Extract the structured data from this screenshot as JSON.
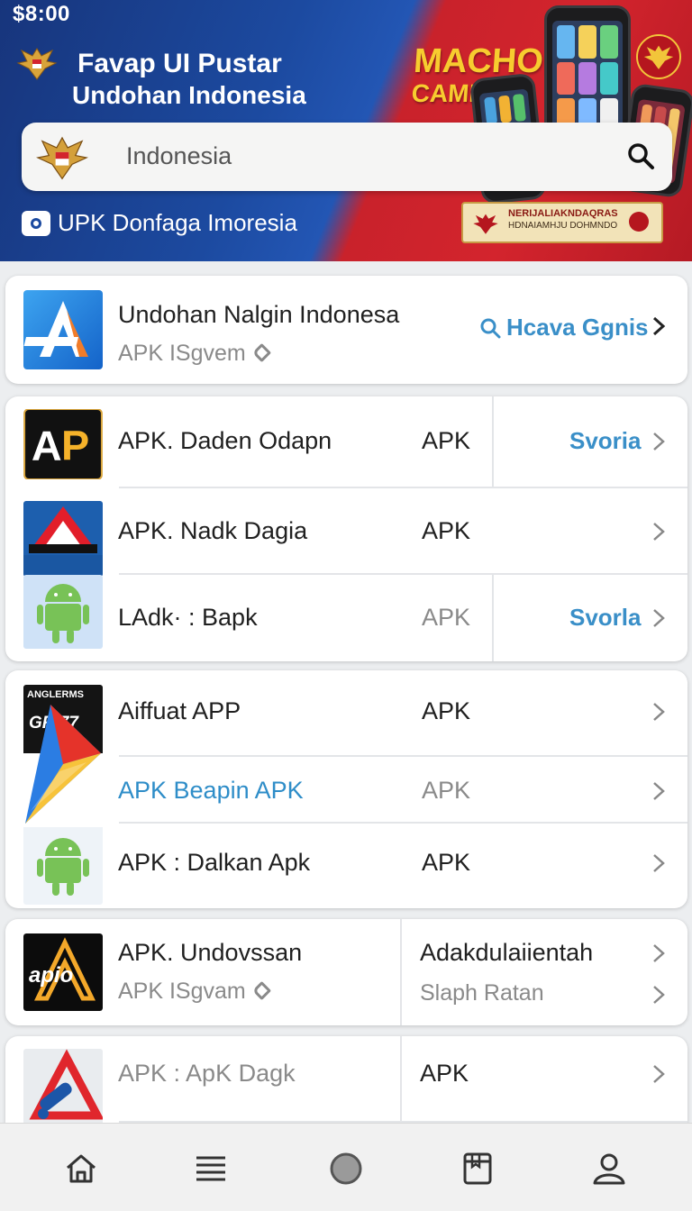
{
  "status": {
    "time": "$8:00"
  },
  "header": {
    "title": "Favap UI Pustar",
    "subtitle": "Undohan Indonesia",
    "promo_line1": "MACHON",
    "promo_line2": "CAMI",
    "ticket_line1": "NERIJALIAKNDAQRAS",
    "ticket_line2": "HDNAIAMHJU DOHMNDO",
    "note": "UPK Donfaga Imoresia",
    "colors": {
      "blue": "#1c4aa0",
      "red": "#d3242d",
      "gold": "#f7cc2f"
    }
  },
  "search": {
    "placeholder": "Indonesia",
    "icon": "search-icon"
  },
  "featured": {
    "name": "Undohan Nalgin Indonesa",
    "sub": "APK ISgvem",
    "action": "Hcava Ggnis",
    "action_icon": "search-icon"
  },
  "group1": [
    {
      "name": "APK. Daden Odapn",
      "kind": "APK",
      "action": "Svoria",
      "icon": "ap-logo-icon"
    },
    {
      "name": "APK. Nadk Dagia",
      "kind": "APK",
      "action": "",
      "icon": "red-a-icon"
    },
    {
      "name": "LAdk· : Bapk",
      "kind": "APK",
      "action": "Svorla",
      "icon": "android-icon"
    }
  ],
  "group2": [
    {
      "name": "Aiffuat APP",
      "kind": "APK",
      "icon": "game-icon",
      "icon_text_1": "ANGLERMS",
      "icon_text_2": "GR 77"
    },
    {
      "name": "APK Beapin  APK",
      "kind": "APK",
      "icon": "play-store-icon"
    },
    {
      "name": "APK : Dalkan Apk",
      "kind": "APK",
      "icon": "android-icon"
    }
  ],
  "group3": {
    "name": "APK. Undovssan",
    "sub": "APK ISgvam",
    "col2_title": "Adakdulaiientah",
    "col2_sub": "Slaph Ratan",
    "icon_text": "apio",
    "icon": "apio-logo-icon"
  },
  "group4": {
    "name": "APK : ApK Dagk",
    "kind": "APK",
    "icon": "wrench-triangle-icon"
  },
  "nav": [
    "home-icon",
    "menu-icon",
    "circle-icon",
    "book-icon",
    "profile-icon"
  ]
}
